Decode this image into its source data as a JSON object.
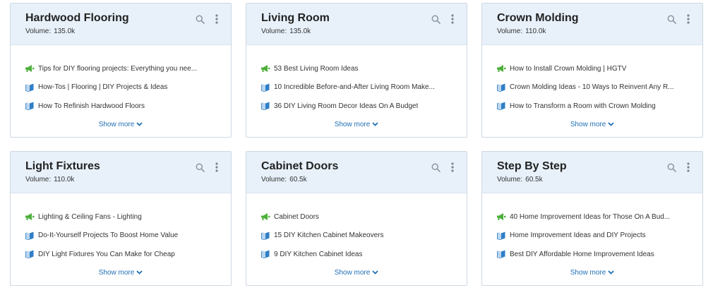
{
  "volume_label": "Volume:",
  "show_more_label": "Show more",
  "colors": {
    "header_bg": "#e8f1fa",
    "link_blue": "#1f6fb5",
    "megaphone_green": "#4caf3a",
    "book_blue": "#2f7fc8"
  },
  "cards": [
    {
      "title": "Hardwood Flooring",
      "volume": "135.0k",
      "items": [
        {
          "icon": "megaphone-icon",
          "text": "Tips for DIY flooring projects: Everything you nee..."
        },
        {
          "icon": "book-icon",
          "text": "How-Tos | Flooring | DIY Projects & Ideas"
        },
        {
          "icon": "book-icon",
          "text": "How To Refinish Hardwood Floors"
        }
      ]
    },
    {
      "title": "Living Room",
      "volume": "135.0k",
      "items": [
        {
          "icon": "megaphone-icon",
          "text": "53 Best Living Room Ideas"
        },
        {
          "icon": "book-icon",
          "text": "10 Incredible Before-and-After Living Room Make..."
        },
        {
          "icon": "book-icon",
          "text": "36 DIY Living Room Decor Ideas On A Budget"
        }
      ]
    },
    {
      "title": "Crown Molding",
      "volume": "110.0k",
      "items": [
        {
          "icon": "megaphone-icon",
          "text": "How to Install Crown Molding | HGTV"
        },
        {
          "icon": "book-icon",
          "text": "Crown Molding Ideas - 10 Ways to Reinvent Any R..."
        },
        {
          "icon": "book-icon",
          "text": "How to Transform a Room with Crown Molding"
        }
      ]
    },
    {
      "title": "Light Fixtures",
      "volume": "110.0k",
      "items": [
        {
          "icon": "megaphone-icon",
          "text": "Lighting & Ceiling Fans - Lighting"
        },
        {
          "icon": "book-icon",
          "text": "Do-It-Yourself Projects To Boost Home Value"
        },
        {
          "icon": "book-icon",
          "text": "DIY Light Fixtures You Can Make for Cheap"
        }
      ]
    },
    {
      "title": "Cabinet Doors",
      "volume": "60.5k",
      "items": [
        {
          "icon": "megaphone-icon",
          "text": "Cabinet Doors"
        },
        {
          "icon": "book-icon",
          "text": "15 DIY Kitchen Cabinet Makeovers"
        },
        {
          "icon": "book-icon",
          "text": "9 DIY Kitchen Cabinet Ideas"
        }
      ]
    },
    {
      "title": "Step By Step",
      "volume": "60.5k",
      "items": [
        {
          "icon": "megaphone-icon",
          "text": "40 Home Improvement Ideas for Those On A Bud..."
        },
        {
          "icon": "book-icon",
          "text": "Home Improvement Ideas and DIY Projects"
        },
        {
          "icon": "book-icon",
          "text": "Best DIY Affordable Home Improvement Ideas"
        }
      ]
    }
  ]
}
